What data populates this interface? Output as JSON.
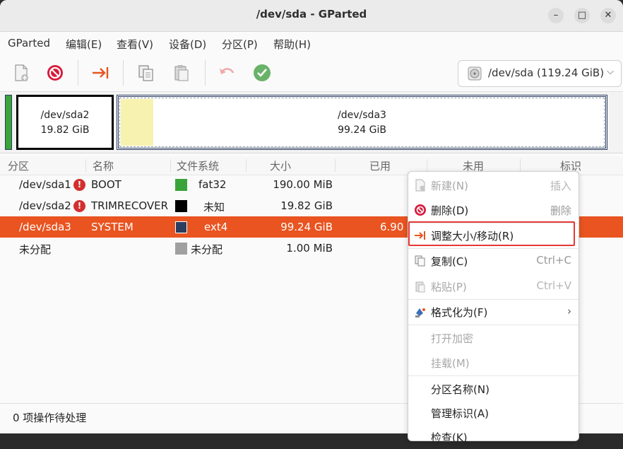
{
  "window": {
    "title": "/dev/sda - GParted",
    "minimize_glyph": "–",
    "maximize_glyph": "□",
    "close_glyph": "✕"
  },
  "menubar": {
    "items": [
      "GParted",
      "编辑(E)",
      "查看(V)",
      "设备(D)",
      "分区(P)",
      "帮助(H)"
    ]
  },
  "toolbar": {
    "icons": [
      "new-partition-icon",
      "delete-icon",
      "resize-move-icon",
      "copy-icon",
      "paste-icon",
      "undo-icon",
      "apply-icon"
    ],
    "device_selector": "/dev/sda (119.24 GiB)",
    "chevron": "⌵"
  },
  "disk_map": {
    "partitions": [
      {
        "name": "/dev/sda2",
        "size": "19.82 GiB"
      },
      {
        "name": "/dev/sda3",
        "size": "99.24 GiB"
      }
    ],
    "colors": {
      "sda1": "#3aa43a",
      "sda3_used": "#f7f2b0",
      "sda3_border": "#2c3e60"
    }
  },
  "table": {
    "headers": [
      "分区",
      "名称",
      "文件系统",
      "大小",
      "已用",
      "未用",
      "标识"
    ],
    "rows": [
      {
        "partition": "/dev/sda1",
        "warning": "!",
        "name": "BOOT",
        "fs": "fat32",
        "fs_color": "#3aa43a",
        "size": "190.00 MiB",
        "used": ""
      },
      {
        "partition": "/dev/sda2",
        "warning": "!",
        "name": "TRIMRECOVER",
        "fs": "未知",
        "fs_color": "#000000",
        "size": "19.82 GiB",
        "used": ""
      },
      {
        "partition": "/dev/sda3",
        "warning": "",
        "name": "SYSTEM",
        "fs": "ext4",
        "fs_color": "#2c3e60",
        "size": "99.24 GiB",
        "used": "6.90 G"
      },
      {
        "partition": "未分配",
        "warning": "",
        "name": "",
        "fs": "未分配",
        "fs_color": "#a0a0a0",
        "size": "1.00 MiB",
        "used": ""
      }
    ]
  },
  "status": {
    "text": "0 项操作待处理"
  },
  "context_menu": {
    "items": [
      {
        "label": "新建(N)",
        "accel": "插入",
        "icon": "new-partition-icon",
        "enabled": false
      },
      {
        "label": "删除(D)",
        "accel": "删除",
        "icon": "delete-icon",
        "enabled": true
      },
      {
        "label": "调整大小/移动(R)",
        "accel": "",
        "icon": "resize-move-icon",
        "enabled": true
      },
      {
        "label": "复制(C)",
        "accel": "Ctrl+C",
        "icon": "copy-icon",
        "enabled": true
      },
      {
        "label": "粘贴(P)",
        "accel": "Ctrl+V",
        "icon": "paste-icon",
        "enabled": false
      },
      {
        "label": "格式化为(F)",
        "accel": "›",
        "icon": "format-icon",
        "enabled": true
      },
      {
        "label": "打开加密",
        "accel": "",
        "icon": "",
        "enabled": false
      },
      {
        "label": "挂载(M)",
        "accel": "",
        "icon": "",
        "enabled": false
      },
      {
        "label": "分区名称(N)",
        "accel": "",
        "icon": "",
        "enabled": true
      },
      {
        "label": "管理标识(A)",
        "accel": "",
        "icon": "",
        "enabled": true
      },
      {
        "label": "检查(K)",
        "accel": "",
        "icon": "",
        "enabled": true
      }
    ],
    "highlight_color": "#e53935"
  },
  "accent": "#e95420"
}
